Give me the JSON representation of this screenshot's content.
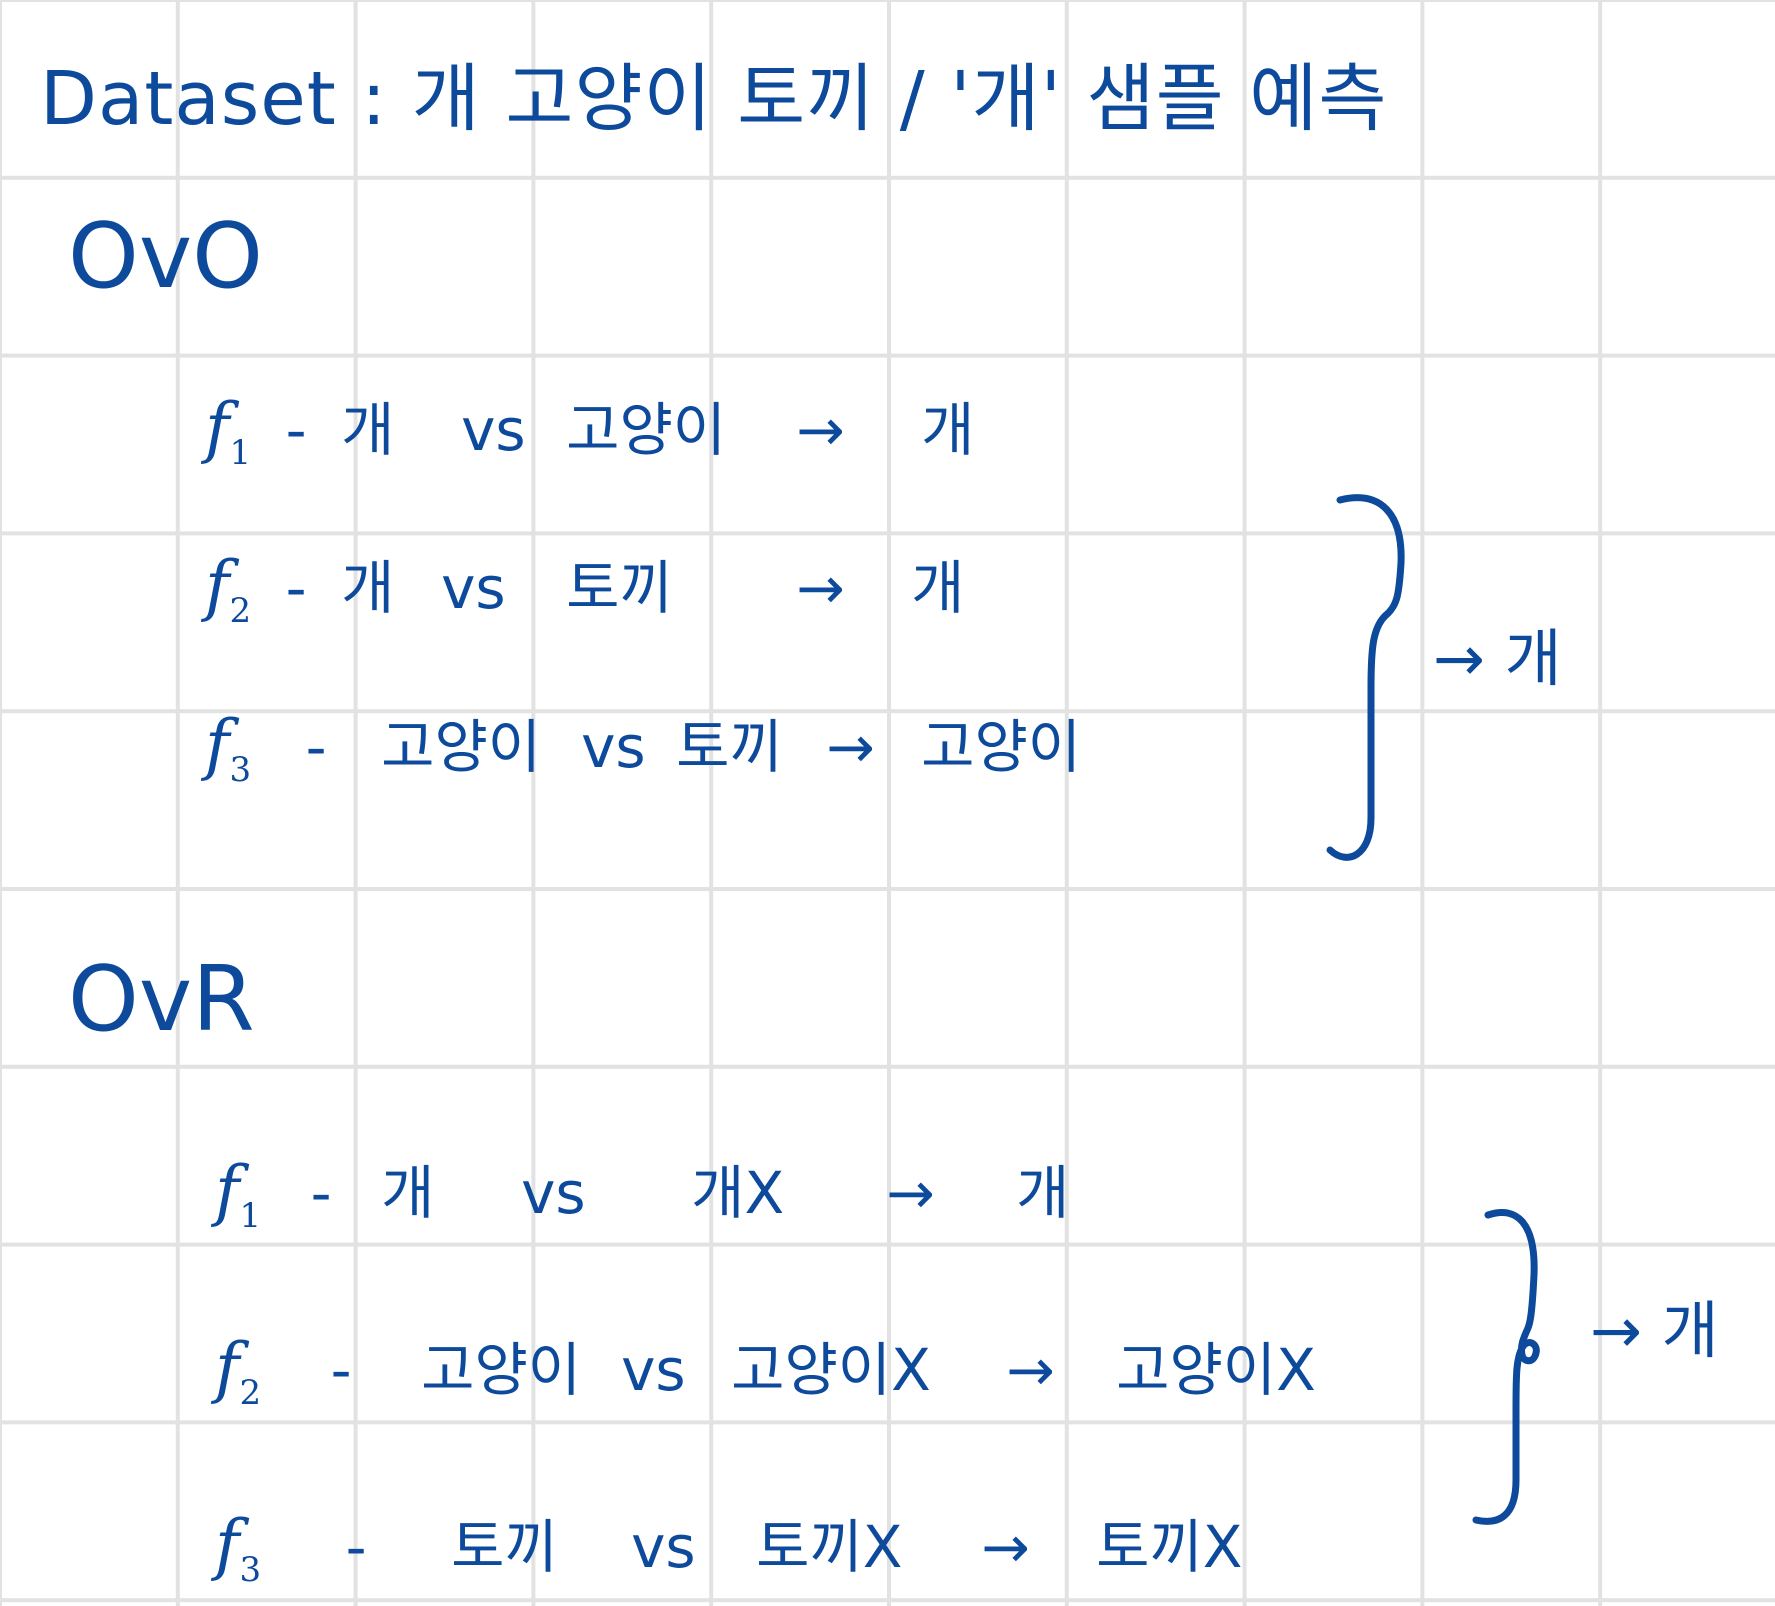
{
  "title": "Dataset : 개 고양이 토끼 / '개' 샘플 예측",
  "ovo": {
    "heading": "OvO",
    "rows": [
      {
        "func": "f",
        "sub": "1",
        "dash": "-",
        "a": "개",
        "vs": "vs",
        "b": "고양이",
        "arrow": "→",
        "pred": "개"
      },
      {
        "func": "f",
        "sub": "2",
        "dash": "-",
        "a": "개",
        "vs": "vs",
        "b": "토끼",
        "arrow": "→",
        "pred": "개"
      },
      {
        "func": "f",
        "sub": "3",
        "dash": "-",
        "a": "고양이",
        "vs": "vs",
        "b": "토끼",
        "arrow": "→",
        "pred": "고양이"
      }
    ],
    "result": "→ 개"
  },
  "ovr": {
    "heading": "OvR",
    "rows": [
      {
        "func": "f",
        "sub": "1",
        "dash": "-",
        "a": "개",
        "vs": "vs",
        "b": "개X",
        "arrow": "→",
        "pred": "개"
      },
      {
        "func": "f",
        "sub": "2",
        "dash": "-",
        "a": "고양이",
        "vs": "vs",
        "b": "고양이X",
        "arrow": "→",
        "pred": "고양이X"
      },
      {
        "func": "f",
        "sub": "3",
        "dash": "-",
        "a": "토끼",
        "vs": "vs",
        "b": "토끼X",
        "arrow": "→",
        "pred": "토끼X"
      }
    ],
    "result": "→ 개"
  }
}
